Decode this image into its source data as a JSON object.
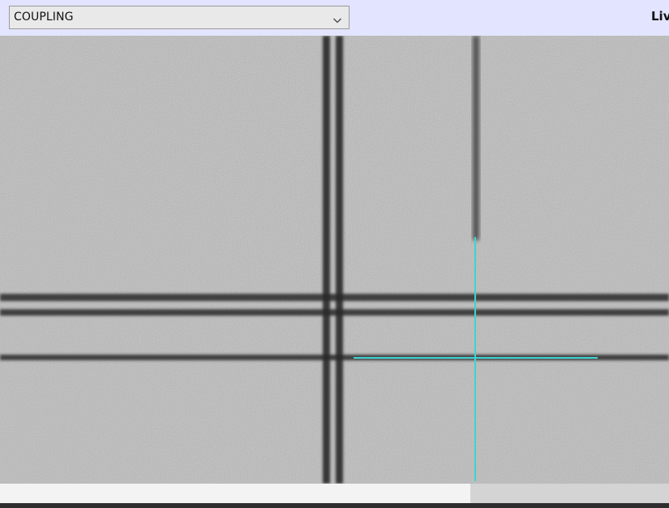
{
  "toolbar": {
    "profile_select": {
      "value": "COUPLING"
    },
    "mode_label": "Liv"
  },
  "camera_view": {
    "crosshair_color": "#3cd4d4",
    "line_color": "#333333"
  },
  "icons": {
    "select_chevron": "chevron-down-icon"
  }
}
